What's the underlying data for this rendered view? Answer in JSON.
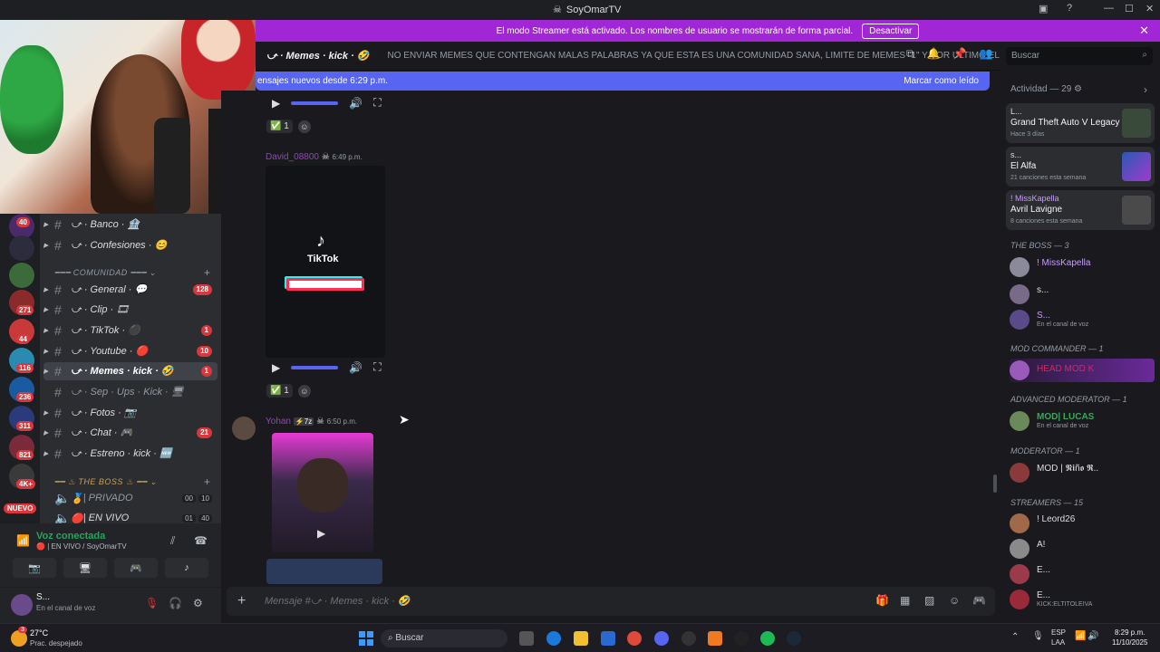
{
  "window": {
    "title": "SoyOmarTV"
  },
  "banner": {
    "text": "El modo Streamer está activado. Los nombres de usuario se mostrarán de forma parcial.",
    "button": "Desactivar"
  },
  "header": {
    "channel": "⤻ · Memes · kick · 🤣",
    "topic": "NO ENVIAR MEMES QUE CONTENGAN MALAS PALABRAS YA QUE ESTA ES UNA COMUNIDAD SANA, LIMITE DE MEMES \"1\" Y POR ULTIMO EL ...",
    "search_placeholder": "Buscar"
  },
  "new_messages": {
    "text": "ensajes nuevos desde 6:29 p.m.",
    "action": "Marcar como leído"
  },
  "servers": [
    {
      "badge": "40"
    },
    {
      "badge": ""
    },
    {
      "badge": ""
    },
    {
      "badge": "271"
    },
    {
      "badge": "44"
    },
    {
      "badge": "116"
    },
    {
      "badge": "236"
    },
    {
      "badge": "311"
    },
    {
      "badge": "821"
    },
    {
      "badge": "4K+"
    }
  ],
  "servers_new": "NUEVO",
  "channels": [
    {
      "label": "⤻ · Banco · 🏦",
      "count": ""
    },
    {
      "label": "⤻ · Confesiones · 😊",
      "count": ""
    },
    {
      "label": "⤻ · General · 💬",
      "count": "128"
    },
    {
      "label": "⤻ · Clip · 🎞",
      "count": ""
    },
    {
      "label": "⤻ · TikTok · ⚫",
      "count": "1"
    },
    {
      "label": "⤻ · Youtube · 🔴",
      "count": "10"
    },
    {
      "label": "⤻ · Memes · kick · 🤣",
      "count": "1"
    },
    {
      "label": "⤻ · Sep · Ups · Kick · 🖥",
      "count": ""
    },
    {
      "label": "⤻ · Fotos · 📷",
      "count": ""
    },
    {
      "label": "⤻ · Chat · 🎮",
      "count": "21"
    },
    {
      "label": "⤻ · Estreno · kick · 🆕",
      "count": ""
    }
  ],
  "category_comunidad": "COMUNIDAD",
  "category_boss": "THE BOSS",
  "voice_channels": [
    {
      "label": "| PRIVADO",
      "a": "00",
      "b": "10"
    },
    {
      "label": "| EN VIVO",
      "a": "01",
      "b": "40"
    }
  ],
  "voice": {
    "status": "Voz conectada",
    "channel": "| EN VIVO / SoyOmarTV"
  },
  "user": {
    "name": "S...",
    "status": "En el canal de voz"
  },
  "messages": [
    {
      "author": "David_08800",
      "time": "6:49 p.m."
    },
    {
      "author": "Yohan",
      "tag": "7z",
      "time": "6:50 p.m."
    }
  ],
  "reaction_count": "1",
  "tiktok_label": "TikTok",
  "composer_placeholder": "Mensaje #⤻ · Memes · kick · 🤣",
  "activity": {
    "title": "Actividad — 29",
    "items": [
      {
        "user": "L...",
        "title": "Grand Theft Auto V Legacy",
        "sub": "Hace 3 días"
      },
      {
        "user": "s...",
        "title": "El Alfa",
        "sub": "21 canciones esta semana"
      },
      {
        "user": "! MissKapella",
        "title": "Avril Lavigne",
        "sub": "8 canciones esta semana"
      }
    ]
  },
  "member_groups": {
    "boss": "THE BOSS — 3",
    "mod_commander": "MOD COMMANDER — 1",
    "adv_mod": "ADVANCED MODERATOR — 1",
    "moderator": "MODERATOR — 1",
    "streamers": "STREAMERS — 15"
  },
  "members": [
    {
      "name": "! MissKapella",
      "sub": "",
      "color": "#c89bff"
    },
    {
      "name": "s...",
      "sub": "",
      "color": "#dbdee1"
    },
    {
      "name": "S...",
      "sub": "En el canal de voz",
      "color": "#c89bff"
    },
    {
      "name": "HEAD MOD K",
      "sub": "",
      "color": "#e0245e"
    },
    {
      "name": "MOD| LUCAS",
      "sub": "En el canal de voz",
      "color": "#3ba55c"
    },
    {
      "name": "MOD | 𝕹𝖎ñ𝖔 𝕽..",
      "sub": "",
      "color": "#dbdee1"
    },
    {
      "name": "! Leord26",
      "sub": "",
      "color": "#dbdee1"
    },
    {
      "name": "A!",
      "sub": "",
      "color": "#dbdee1"
    },
    {
      "name": "E...",
      "sub": "",
      "color": "#dbdee1"
    },
    {
      "name": "E...",
      "sub": "KICK:ELTITOLEIVA",
      "color": "#dbdee1"
    }
  ],
  "taskbar": {
    "weather_temp": "27°C",
    "weather_desc": "Prac. despejado",
    "search": "Buscar",
    "lang_top": "ESP",
    "lang_bottom": "LAA",
    "time": "8:29 p.m.",
    "date": "11/10/2025",
    "notif": "3"
  }
}
